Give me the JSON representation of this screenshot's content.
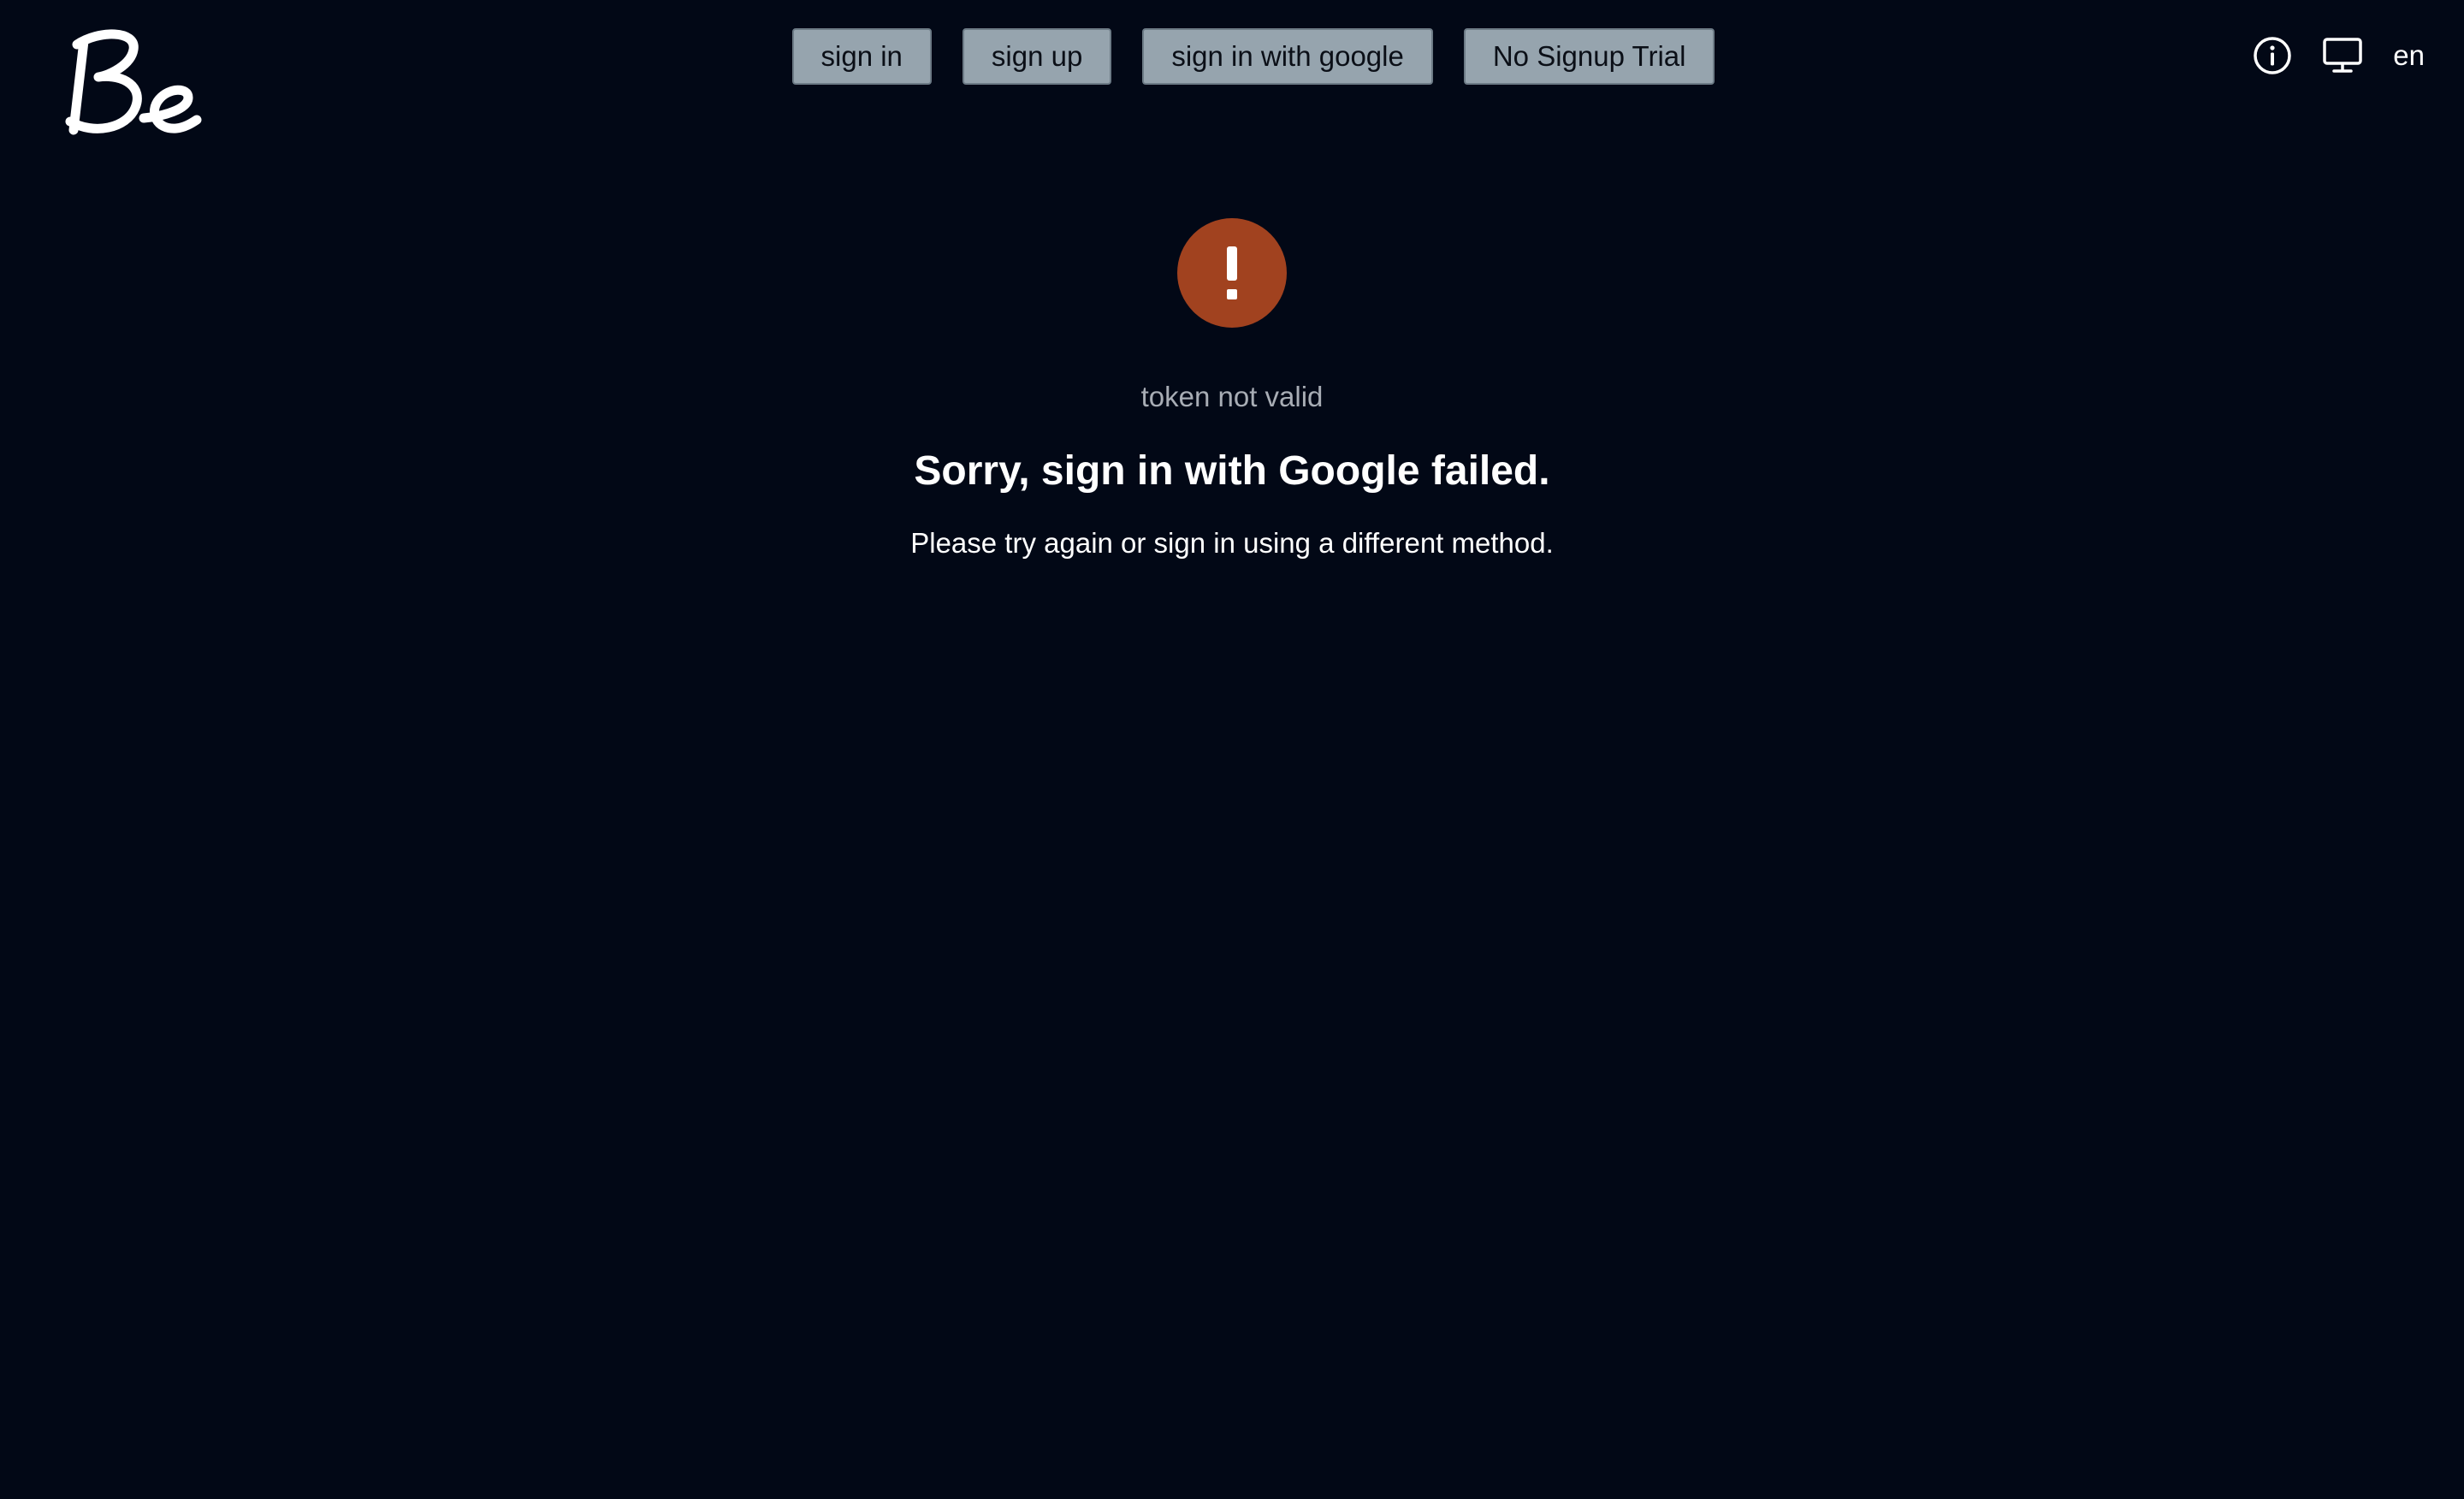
{
  "brand": {
    "logo_text": "Be"
  },
  "nav": {
    "sign_in": "sign in",
    "sign_up": "sign up",
    "sign_in_google": "sign in with google",
    "trial": "No Signup Trial"
  },
  "toolbar": {
    "info_icon": "info-icon",
    "display_icon": "monitor-icon",
    "language": "en"
  },
  "error": {
    "icon": "exclamation-icon",
    "icon_color": "#a1421f",
    "code": "token not valid",
    "title": "Sorry, sign in with Google failed.",
    "message": "Please try again or sign in using a different method."
  },
  "colors": {
    "background": "#020816",
    "button_bg": "#96a4ae",
    "muted_text": "#a8adb5"
  }
}
